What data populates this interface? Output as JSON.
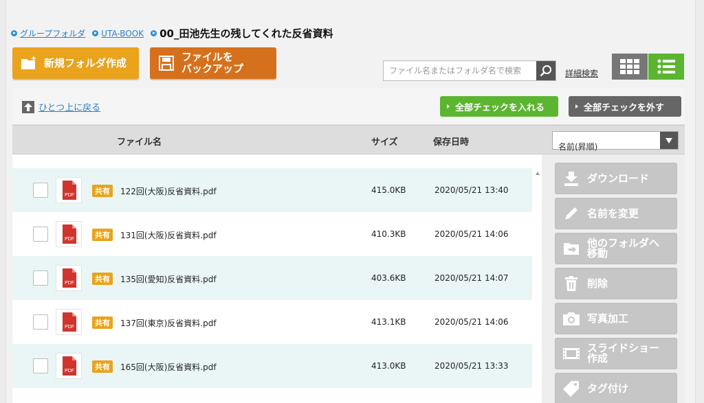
{
  "breadcrumb": {
    "items": [
      "グループフォルダ",
      "UTA-BOOK"
    ],
    "current": "00_田池先生の残してくれた反省資料"
  },
  "toolbar": {
    "new_folder": "新規フォルダ作成",
    "backup_line1": "ファイルを",
    "backup_line2": "バックアップ",
    "search_placeholder": "ファイル名またはフォルダ名で検索",
    "advanced_search": "詳細検索",
    "up": "ひとつ上に戻る",
    "check_all": "全部チェックを入れる",
    "uncheck_all": "全部チェックを外す"
  },
  "table": {
    "headers": {
      "name": "ファイル名",
      "size": "サイズ",
      "date": "保存日時"
    },
    "sort": "名前(昇順)",
    "rows": [
      {
        "badge": "共有",
        "name": "122回(大阪)反省資料.pdf",
        "size": "415.0KB",
        "date": "2020/05/21 13:40",
        "icon": "PDF"
      },
      {
        "badge": "共有",
        "name": "131回(大阪)反省資料.pdf",
        "size": "410.3KB",
        "date": "2020/05/21 14:06",
        "icon": "PDF"
      },
      {
        "badge": "共有",
        "name": "135回(愛知)反省資料.pdf",
        "size": "403.6KB",
        "date": "2020/05/21 14:07",
        "icon": "PDF"
      },
      {
        "badge": "共有",
        "name": "137回(東京)反省資料.pdf",
        "size": "413.1KB",
        "date": "2020/05/21 14:06",
        "icon": "PDF"
      },
      {
        "badge": "共有",
        "name": "165回(大阪)反省資料.pdf",
        "size": "413.0KB",
        "date": "2020/05/21 13:33",
        "icon": "PDF"
      }
    ]
  },
  "actions": {
    "download": "ダウンロード",
    "rename": "名前を変更",
    "move_line1": "他のフォルダへ",
    "move_line2": "移動",
    "delete": "削除",
    "photo_edit": "写真加工",
    "slideshow_line1": "スライドショー",
    "slideshow_line2": "作成",
    "tag": "タグ付け"
  },
  "colors": {
    "accent_green": "#5cb531",
    "orange": "#e9a31c",
    "dark_orange": "#d5711c",
    "row_tint": "#eaf6f6",
    "link": "#2a7fc4"
  }
}
